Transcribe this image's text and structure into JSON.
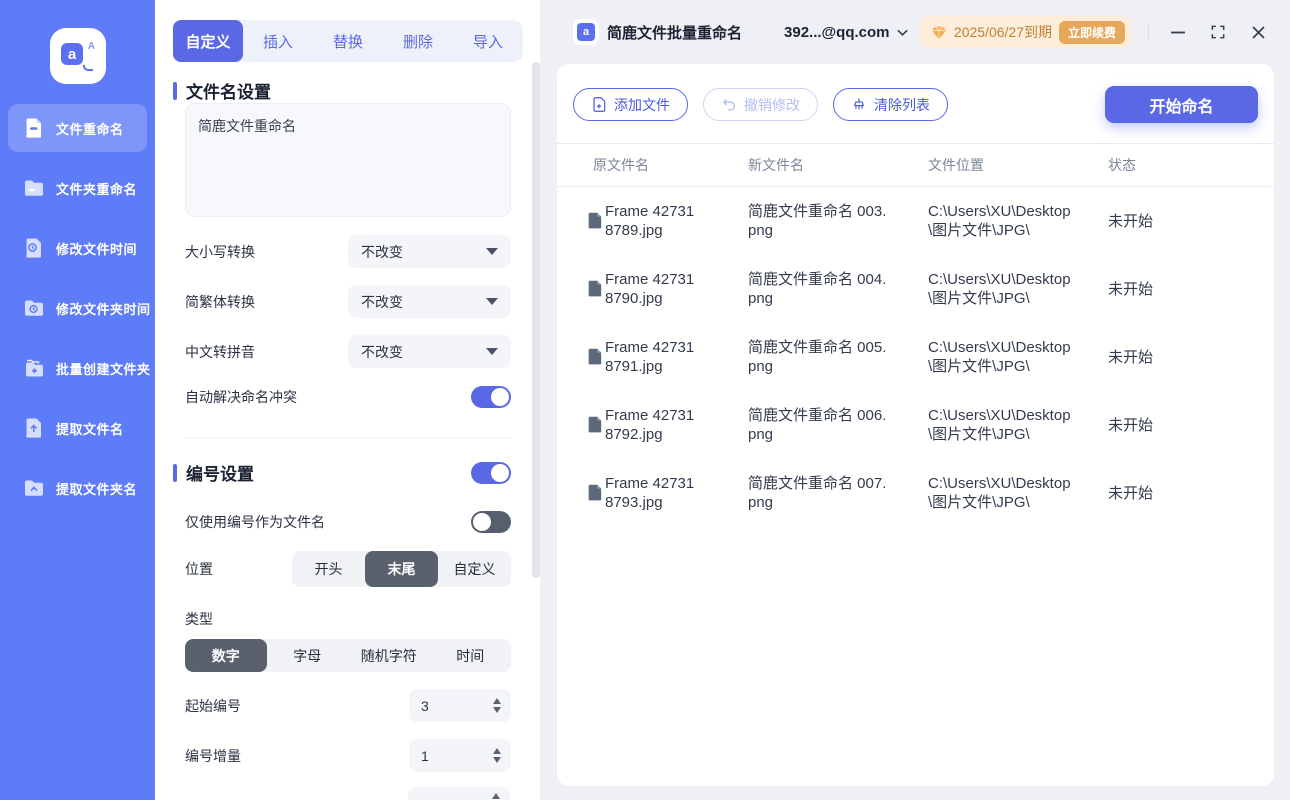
{
  "colors": {
    "accent": "#5a68e6",
    "sidebar": "#5f7cf8",
    "selected-dark": "#5b606f",
    "warning-bg": "#fdeedb",
    "warning-text": "#bb8233",
    "warning-button": "#e8a85b"
  },
  "sidebar": {
    "items": [
      {
        "label": "文件重命名",
        "active": true
      },
      {
        "label": "文件夹重命名",
        "active": false
      },
      {
        "label": "修改文件时间",
        "active": false
      },
      {
        "label": "修改文件夹时间",
        "active": false
      },
      {
        "label": "批量创建文件夹",
        "active": false
      },
      {
        "label": "提取文件名",
        "active": false
      },
      {
        "label": "提取文件夹名",
        "active": false
      }
    ]
  },
  "settings": {
    "tabs": [
      "自定义",
      "插入",
      "替换",
      "删除",
      "导入"
    ],
    "active_tab": "自定义",
    "filename_section_title": "文件名设置",
    "filename_value": "简鹿文件重命名",
    "converts": [
      {
        "label": "大小写转换",
        "value": "不改变"
      },
      {
        "label": "简繁体转换",
        "value": "不改变"
      },
      {
        "label": "中文转拼音",
        "value": "不改变"
      }
    ],
    "auto_resolve_label": "自动解决命名冲突",
    "numbering_section_title": "编号设置",
    "only_number_label": "仅使用编号作为文件名",
    "position_label": "位置",
    "position_options": [
      "开头",
      "末尾",
      "自定义"
    ],
    "position_selected": "末尾",
    "type_label": "类型",
    "type_options": [
      "数字",
      "字母",
      "随机字符",
      "时间"
    ],
    "type_selected": "数字",
    "start_number_label": "起始编号",
    "start_number_value": "3",
    "increment_label": "编号增量",
    "increment_value": "1"
  },
  "window": {
    "title": "简鹿文件批量重命名",
    "account": "392...@qq.com",
    "license_expiry": "2025/06/27到期",
    "renew_label": "立即续费"
  },
  "toolbar": {
    "add_files": "添加文件",
    "undo": "撤销修改",
    "clear": "清除列表",
    "start": "开始命名"
  },
  "table": {
    "headers": [
      "原文件名",
      "新文件名",
      "文件位置",
      "状态"
    ],
    "rows": [
      {
        "original": "Frame 42731 8789.jpg",
        "new_name": "简鹿文件重命名 003.png",
        "location": "C:\\Users\\XU\\Desktop\\图片文件\\JPG\\",
        "status": "未开始"
      },
      {
        "original": "Frame 42731 8790.jpg",
        "new_name": "简鹿文件重命名 004.png",
        "location": "C:\\Users\\XU\\Desktop\\图片文件\\JPG\\",
        "status": "未开始"
      },
      {
        "original": "Frame 42731 8791.jpg",
        "new_name": "简鹿文件重命名 005.png",
        "location": "C:\\Users\\XU\\Desktop\\图片文件\\JPG\\",
        "status": "未开始"
      },
      {
        "original": "Frame 42731 8792.jpg",
        "new_name": "简鹿文件重命名 006.png",
        "location": "C:\\Users\\XU\\Desktop\\图片文件\\JPG\\",
        "status": "未开始"
      },
      {
        "original": "Frame 42731 8793.jpg",
        "new_name": "简鹿文件重命名 007.png",
        "location": "C:\\Users\\XU\\Desktop\\图片文件\\JPG\\",
        "status": "未开始"
      }
    ]
  }
}
